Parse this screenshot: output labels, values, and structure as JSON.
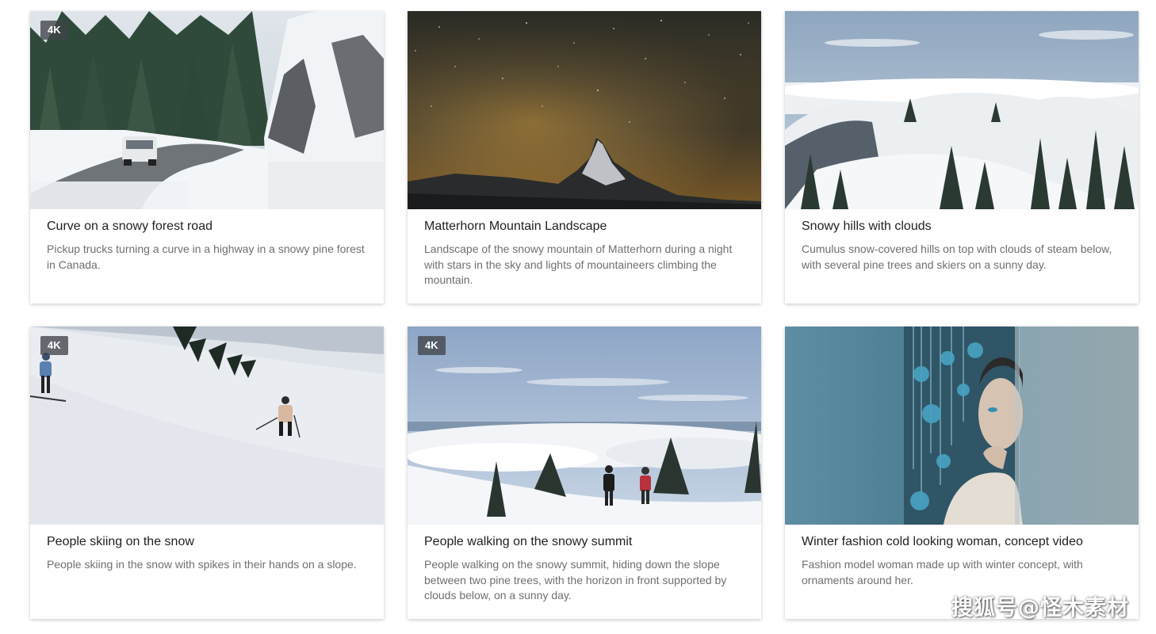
{
  "cards": [
    {
      "title": "Curve on a snowy forest road",
      "description": "Pickup trucks turning a curve in a highway in a snowy pine forest in Canada.",
      "badge": "4K"
    },
    {
      "title": "Matterhorn Mountain Landscape",
      "description": "Landscape of the snowy mountain of Matterhorn during a night with stars in the sky and lights of mountaineers climbing the mountain.",
      "badge": ""
    },
    {
      "title": "Snowy hills with clouds",
      "description": "Cumulus snow-covered hills on top with clouds of steam below, with several pine trees and skiers on a sunny day.",
      "badge": ""
    },
    {
      "title": "People skiing on the snow",
      "description": "People skiing in the snow with spikes in their hands on a slope.",
      "badge": "4K"
    },
    {
      "title": "People walking on the snowy summit",
      "description": "People walking on the snowy summit, hiding down the slope between two pine trees, with the horizon in front supported by clouds below, on a sunny day.",
      "badge": "4K"
    },
    {
      "title": "Winter fashion cold looking woman, concept video",
      "description": "Fashion model woman made up with winter concept, with ornaments around her.",
      "badge": ""
    }
  ],
  "watermark": "搜狐号@怪木素材"
}
